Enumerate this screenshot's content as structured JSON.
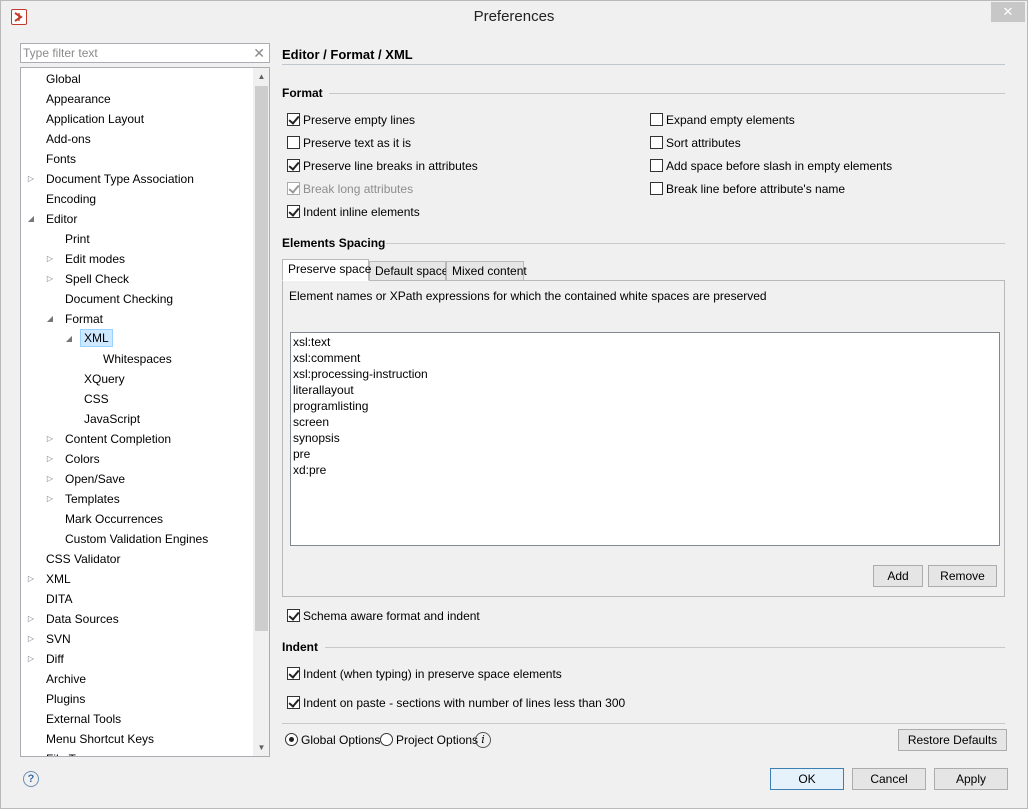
{
  "window": {
    "title": "Preferences",
    "close_label": "✕"
  },
  "filter": {
    "placeholder": "Type filter text",
    "clear_label": "✕"
  },
  "tree": {
    "items": [
      {
        "label": "Global",
        "level": 0,
        "arrow": ""
      },
      {
        "label": "Appearance",
        "level": 0,
        "arrow": ""
      },
      {
        "label": "Application Layout",
        "level": 0,
        "arrow": ""
      },
      {
        "label": "Add-ons",
        "level": 0,
        "arrow": ""
      },
      {
        "label": "Fonts",
        "level": 0,
        "arrow": ""
      },
      {
        "label": "Document Type Association",
        "level": 0,
        "arrow": "collapsed"
      },
      {
        "label": "Encoding",
        "level": 0,
        "arrow": ""
      },
      {
        "label": "Editor",
        "level": 0,
        "arrow": "expanded"
      },
      {
        "label": "Print",
        "level": 1,
        "arrow": ""
      },
      {
        "label": "Edit modes",
        "level": 1,
        "arrow": "collapsed"
      },
      {
        "label": "Spell Check",
        "level": 1,
        "arrow": "collapsed"
      },
      {
        "label": "Document Checking",
        "level": 1,
        "arrow": ""
      },
      {
        "label": "Format",
        "level": 1,
        "arrow": "expanded"
      },
      {
        "label": "XML",
        "level": 2,
        "arrow": "expanded",
        "selected": true
      },
      {
        "label": "Whitespaces",
        "level": 3,
        "arrow": ""
      },
      {
        "label": "XQuery",
        "level": 2,
        "arrow": ""
      },
      {
        "label": "CSS",
        "level": 2,
        "arrow": ""
      },
      {
        "label": "JavaScript",
        "level": 2,
        "arrow": ""
      },
      {
        "label": "Content Completion",
        "level": 1,
        "arrow": "collapsed"
      },
      {
        "label": "Colors",
        "level": 1,
        "arrow": "collapsed"
      },
      {
        "label": "Open/Save",
        "level": 1,
        "arrow": "collapsed"
      },
      {
        "label": "Templates",
        "level": 1,
        "arrow": "collapsed"
      },
      {
        "label": "Mark Occurrences",
        "level": 1,
        "arrow": ""
      },
      {
        "label": "Custom Validation Engines",
        "level": 1,
        "arrow": ""
      },
      {
        "label": "CSS Validator",
        "level": 0,
        "arrow": ""
      },
      {
        "label": "XML",
        "level": 0,
        "arrow": "collapsed"
      },
      {
        "label": "DITA",
        "level": 0,
        "arrow": ""
      },
      {
        "label": "Data Sources",
        "level": 0,
        "arrow": "collapsed"
      },
      {
        "label": "SVN",
        "level": 0,
        "arrow": "collapsed"
      },
      {
        "label": "Diff",
        "level": 0,
        "arrow": "collapsed"
      },
      {
        "label": "Archive",
        "level": 0,
        "arrow": ""
      },
      {
        "label": "Plugins",
        "level": 0,
        "arrow": ""
      },
      {
        "label": "External Tools",
        "level": 0,
        "arrow": ""
      },
      {
        "label": "Menu Shortcut Keys",
        "level": 0,
        "arrow": ""
      },
      {
        "label": "File Types",
        "level": 0,
        "arrow": ""
      }
    ]
  },
  "page": {
    "title": "Editor / Format / XML"
  },
  "format": {
    "heading": "Format",
    "left": [
      {
        "label": "Preserve empty lines",
        "checked": true,
        "disabled": false
      },
      {
        "label": "Preserve text as it is",
        "checked": false,
        "disabled": false
      },
      {
        "label": "Preserve line breaks in attributes",
        "checked": true,
        "disabled": false
      },
      {
        "label": "Break long attributes",
        "checked": true,
        "disabled": true
      },
      {
        "label": "Indent inline elements",
        "checked": true,
        "disabled": false
      }
    ],
    "right": [
      {
        "label": "Expand empty elements",
        "checked": false,
        "disabled": false
      },
      {
        "label": "Sort attributes",
        "checked": false,
        "disabled": false
      },
      {
        "label": "Add space before slash in empty elements",
        "checked": false,
        "disabled": false
      },
      {
        "label": "Break line before attribute's name",
        "checked": false,
        "disabled": false
      }
    ]
  },
  "spacing": {
    "heading": "Elements Spacing",
    "tabs": [
      "Preserve space",
      "Default space",
      "Mixed content"
    ],
    "description": "Element names or XPath expressions for which the contained white spaces are preserved",
    "list": [
      "xsl:text",
      "xsl:comment",
      "xsl:processing-instruction",
      "literallayout",
      "programlisting",
      "screen",
      "synopsis",
      "pre",
      "xd:pre"
    ],
    "add_label": "Add",
    "remove_label": "Remove"
  },
  "schema_aware": {
    "label": "Schema aware format and indent",
    "checked": true
  },
  "indent": {
    "heading": "Indent",
    "options": [
      {
        "label": "Indent (when typing) in preserve space elements",
        "checked": true
      },
      {
        "label": "Indent on paste - sections with number of lines less than 300",
        "checked": true
      }
    ]
  },
  "scope": {
    "global_label": "Global Options",
    "project_label": "Project Options",
    "selected": "global",
    "info_label": "i",
    "restore_label": "Restore Defaults"
  },
  "footer": {
    "help_label": "?",
    "ok_label": "OK",
    "cancel_label": "Cancel",
    "apply_label": "Apply"
  }
}
